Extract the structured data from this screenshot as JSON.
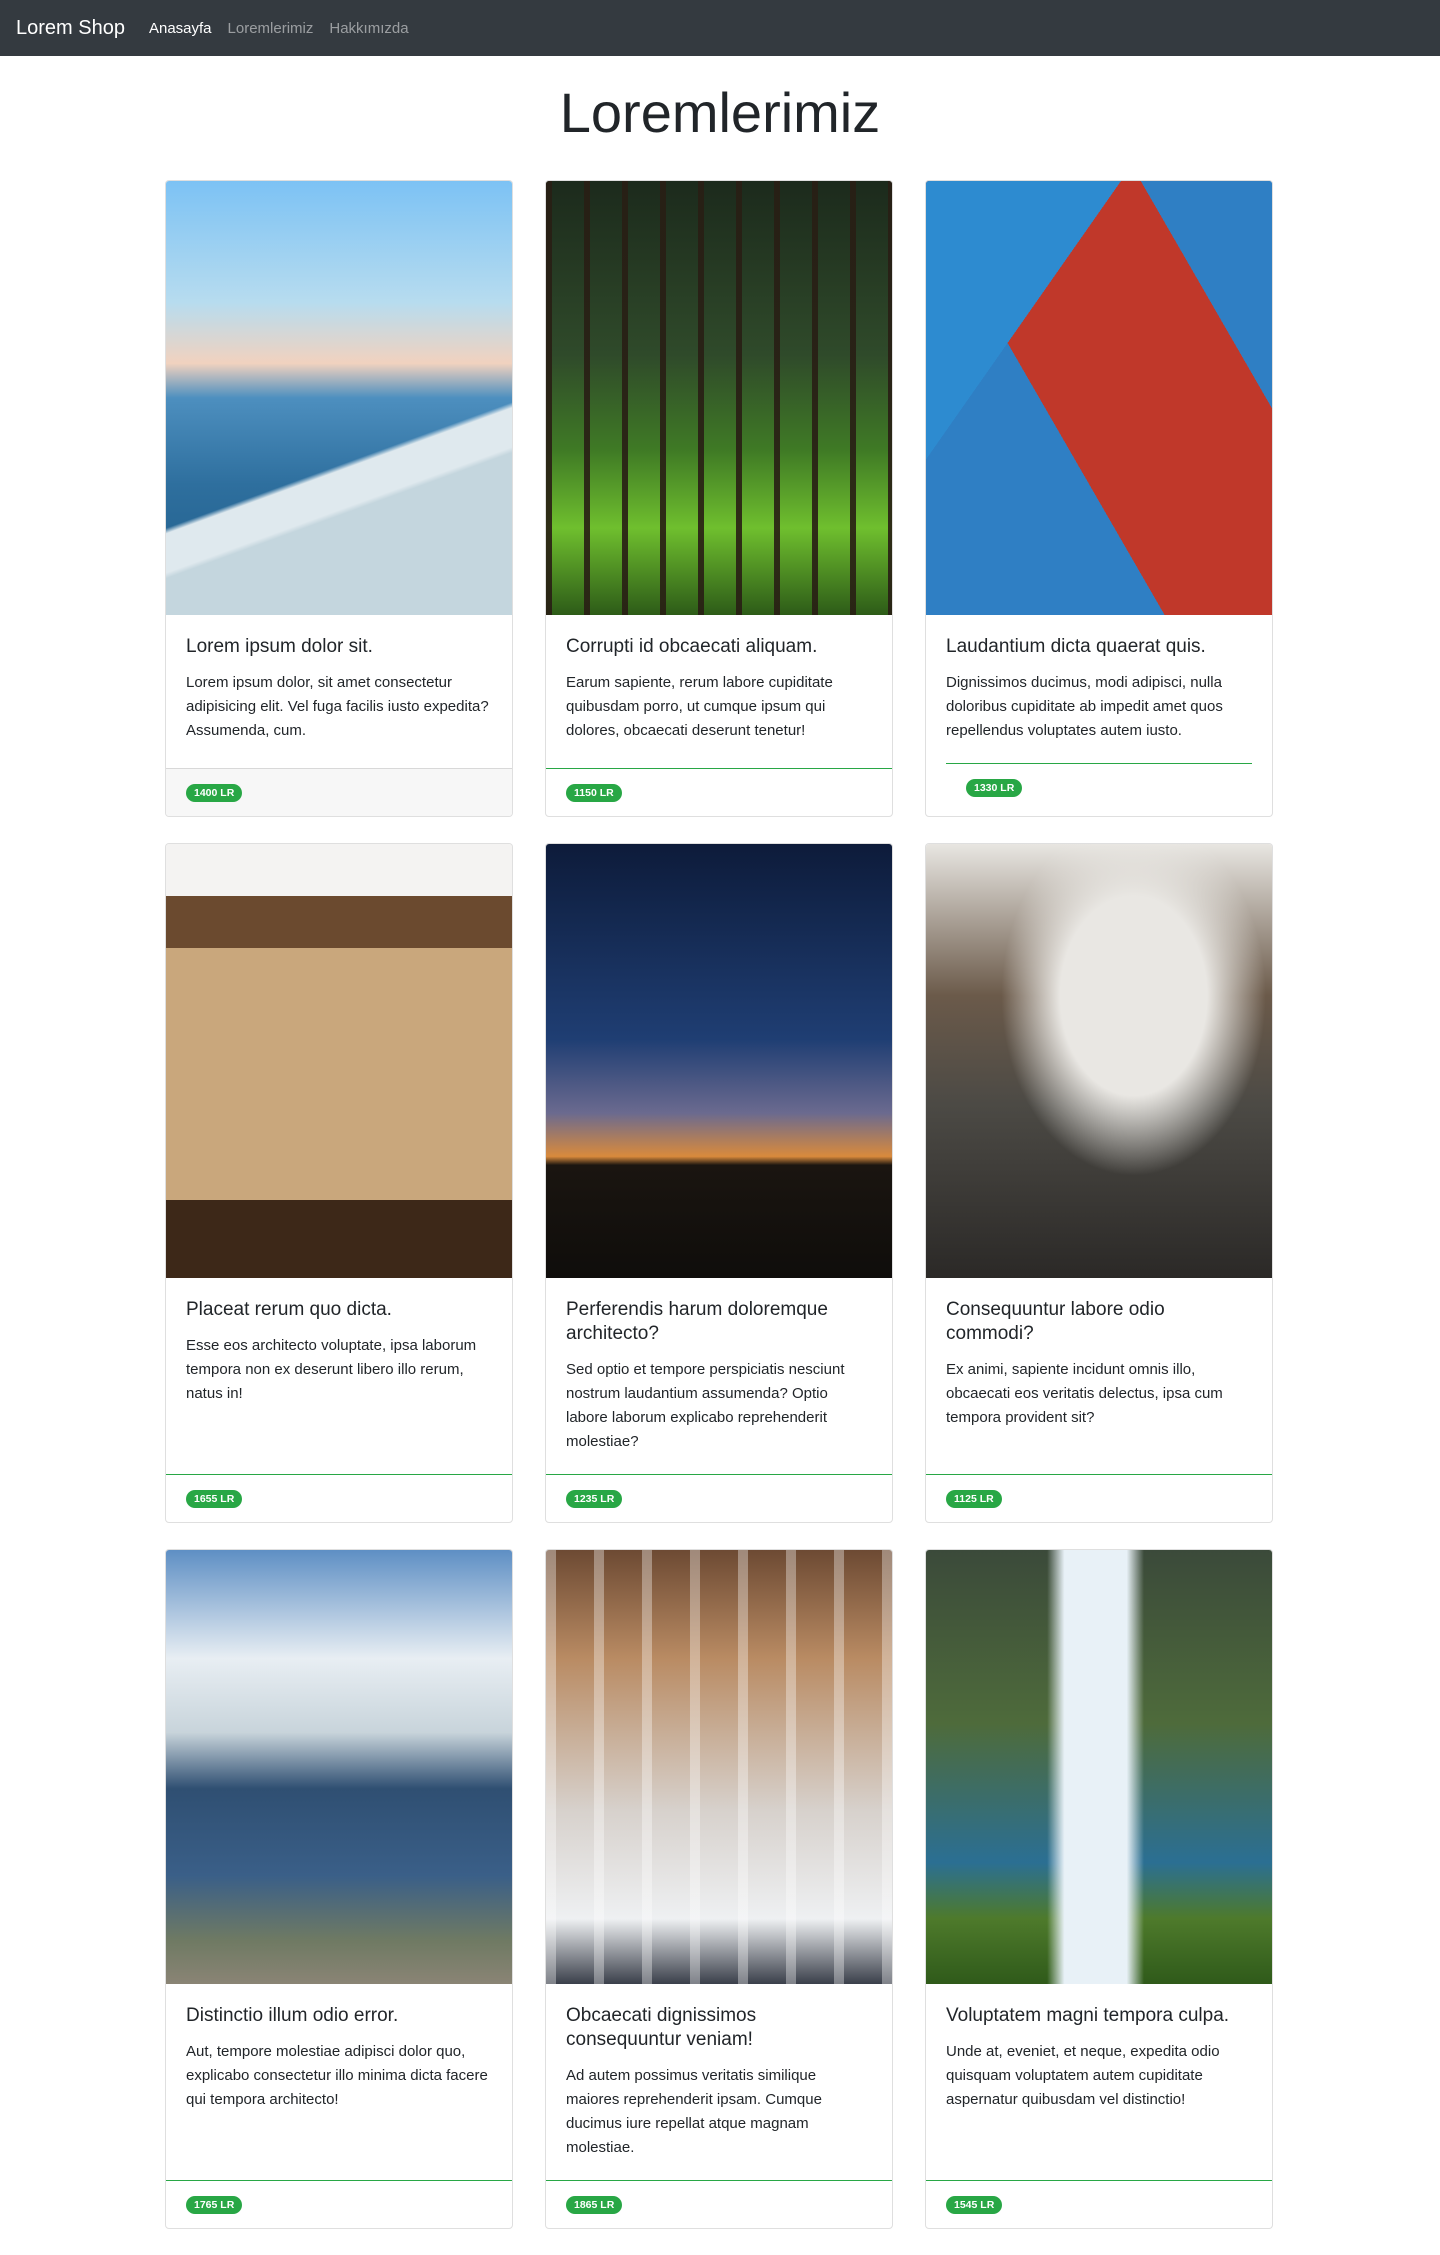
{
  "navbar": {
    "brand": "Lorem Shop",
    "links": [
      {
        "label": "Anasayfa",
        "active": true
      },
      {
        "label": "Loremlerimiz",
        "active": false
      },
      {
        "label": "Hakkımızda",
        "active": false
      }
    ]
  },
  "page": {
    "title": "Loremlerimiz"
  },
  "products": [
    {
      "title": "Lorem ipsum dolor sit.",
      "text": "Lorem ipsum dolor, sit amet consectetur adipisicing elit. Vel fuga facilis iusto expedita? Assumenda, cum.",
      "price": "1400 LR"
    },
    {
      "title": "Corrupti id obcaecati aliquam.",
      "text": "Earum sapiente, rerum labore cupiditate quibusdam porro, ut cumque ipsum qui dolores, obcaecati deserunt tenetur!",
      "price": "1150 LR"
    },
    {
      "title": "Laudantium dicta quaerat quis.",
      "text": "Dignissimos ducimus, modi adipisci, nulla doloribus cupiditate ab impedit amet quos repellendus voluptates autem iusto.",
      "price": "1330 LR"
    },
    {
      "title": "Placeat rerum quo dicta.",
      "text": "Esse eos architecto voluptate, ipsa laborum tempora non ex deserunt libero illo rerum, natus in!",
      "price": "1655 LR"
    },
    {
      "title": "Perferendis harum doloremque architecto?",
      "text": "Sed optio et tempore perspiciatis nesciunt nostrum laudantium assumenda? Optio labore laborum explicabo reprehenderit molestiae?",
      "price": "1235 LR"
    },
    {
      "title": "Consequuntur labore odio commodi?",
      "text": "Ex animi, sapiente incidunt omnis illo, obcaecati eos veritatis delectus, ipsa cum tempora provident sit?",
      "price": "1125 LR"
    },
    {
      "title": "Distinctio illum odio error.",
      "text": "Aut, tempore molestiae adipisci dolor quo, explicabo consectetur illo minima dicta facere qui tempora architecto!",
      "price": "1765 LR"
    },
    {
      "title": "Obcaecati dignissimos consequuntur veniam!",
      "text": "Ad autem possimus veritatis similique maiores reprehenderit ipsam. Cumque ducimus iure repellat atque magnam molestiae.",
      "price": "1865 LR"
    },
    {
      "title": "Voluptatem magni tempora culpa.",
      "text": "Unde at, eveniet, et neque, expedita odio quisquam voluptatem autem cupiditate aspernatur quibusdam vel distinctio!",
      "price": "1545 LR"
    }
  ]
}
